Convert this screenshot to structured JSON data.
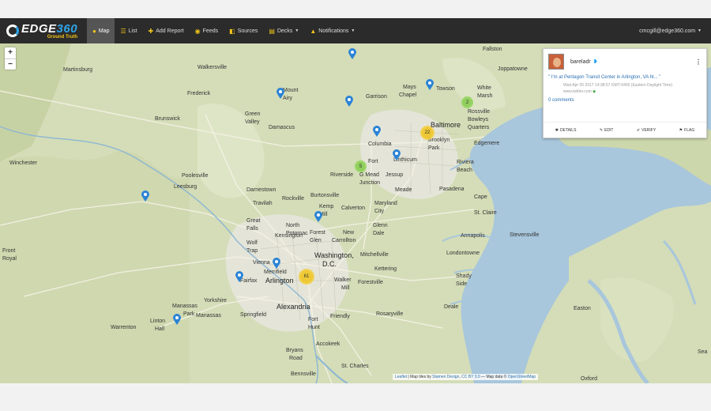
{
  "navbar": {
    "brand_name": "EDGE",
    "brand_number": "360",
    "brand_sub": "Ground Truth",
    "items": [
      {
        "label": "Map",
        "icon": "map-marker-icon",
        "glyph": "●"
      },
      {
        "label": "List",
        "icon": "list-icon",
        "glyph": "☰"
      },
      {
        "label": "Add Report",
        "icon": "plus-icon",
        "glyph": "✚"
      },
      {
        "label": "Feeds",
        "icon": "feed-icon",
        "glyph": "◉"
      },
      {
        "label": "Sources",
        "icon": "sources-icon",
        "glyph": "◧"
      },
      {
        "label": "Decks",
        "icon": "decks-icon",
        "glyph": "▤"
      },
      {
        "label": "Notifications",
        "icon": "bell-icon",
        "glyph": "▲"
      }
    ],
    "user_email": "cmcgill@edge360.com"
  },
  "map": {
    "zoom_in": "+",
    "zoom_out": "−",
    "places": [
      {
        "name": "Fallston"
      },
      {
        "name": "Martinsburg"
      },
      {
        "name": "Walkersville"
      },
      {
        "name": "Joppatowne"
      },
      {
        "name": "Mays"
      },
      {
        "name": "Chapel"
      },
      {
        "name": "Towson"
      },
      {
        "name": "White"
      },
      {
        "name": "Marsh"
      },
      {
        "name": "Frederick"
      },
      {
        "name": "Mount"
      },
      {
        "name": "Airy"
      },
      {
        "name": "Garrison"
      },
      {
        "name": "Green"
      },
      {
        "name": "Valley"
      },
      {
        "name": "Rossville"
      },
      {
        "name": "Bowleys"
      },
      {
        "name": "Quarters"
      },
      {
        "name": "Brunswick"
      },
      {
        "name": "Damascus"
      },
      {
        "name": "Baltimore"
      },
      {
        "name": "Brooklyn"
      },
      {
        "name": "Park"
      },
      {
        "name": "Columbia"
      },
      {
        "name": "Edgemere"
      },
      {
        "name": "Winchester"
      },
      {
        "name": "Fort"
      },
      {
        "name": "Linthicum"
      },
      {
        "name": "Meade"
      },
      {
        "name": "Riviera"
      },
      {
        "name": "Beach"
      },
      {
        "name": "Poolesville"
      },
      {
        "name": "Riverside"
      },
      {
        "name": "G Mead"
      },
      {
        "name": "Junction"
      },
      {
        "name": "Jessup"
      },
      {
        "name": "Pasadena"
      },
      {
        "name": "Leesburg"
      },
      {
        "name": "Darnestown"
      },
      {
        "name": "Burtonsville"
      },
      {
        "name": "Maryland"
      },
      {
        "name": "City"
      },
      {
        "name": "Cape"
      },
      {
        "name": "St. Claire"
      },
      {
        "name": "Travilah"
      },
      {
        "name": "Rockville"
      },
      {
        "name": "Calverton"
      },
      {
        "name": "Kemp"
      },
      {
        "name": "Mill"
      },
      {
        "name": "Great"
      },
      {
        "name": "Falls"
      },
      {
        "name": "North"
      },
      {
        "name": "Potomac"
      },
      {
        "name": "Glenn"
      },
      {
        "name": "Dale"
      },
      {
        "name": "Annapolis"
      },
      {
        "name": "Stevensville"
      },
      {
        "name": "Kensington"
      },
      {
        "name": "Forest"
      },
      {
        "name": "Glen"
      },
      {
        "name": "New"
      },
      {
        "name": "Carrollton"
      },
      {
        "name": "Wolf"
      },
      {
        "name": "Trap"
      },
      {
        "name": "Front"
      },
      {
        "name": "Royal"
      },
      {
        "name": "Londontowne"
      },
      {
        "name": "Washington,"
      },
      {
        "name": "D.C."
      },
      {
        "name": "Mitchellville"
      },
      {
        "name": "Vienna"
      },
      {
        "name": "Merrifield"
      },
      {
        "name": "Kettering"
      },
      {
        "name": "Arlington"
      },
      {
        "name": "Shady"
      },
      {
        "name": "Side"
      },
      {
        "name": "Fairfax"
      },
      {
        "name": "Walker"
      },
      {
        "name": "Forestville"
      },
      {
        "name": "Yorkshire"
      },
      {
        "name": "Mill"
      },
      {
        "name": "Manassas"
      },
      {
        "name": "Park"
      },
      {
        "name": "Alexandria"
      },
      {
        "name": "Springfield"
      },
      {
        "name": "Deale"
      },
      {
        "name": "Easton"
      },
      {
        "name": "Manassas"
      },
      {
        "name": "Linton"
      },
      {
        "name": "Hall"
      },
      {
        "name": "Fort"
      },
      {
        "name": "Hunt"
      },
      {
        "name": "Friendly"
      },
      {
        "name": "Rosaryville"
      },
      {
        "name": "Warrenton"
      },
      {
        "name": "Accokeek"
      },
      {
        "name": "Bryans"
      },
      {
        "name": "Road"
      },
      {
        "name": "St. Charles"
      },
      {
        "name": "Bennsville"
      },
      {
        "name": "Sea"
      },
      {
        "name": "Oxford"
      }
    ],
    "clusters": [
      {
        "label": "2",
        "color": "green"
      },
      {
        "label": "22",
        "color": "yellow"
      },
      {
        "label": "5",
        "color": "green"
      },
      {
        "label": "61",
        "color": "yellow"
      }
    ],
    "attribution": {
      "leaflet": "Leaflet",
      "text1": " | Map tiles by ",
      "stamen": "Stamen Design",
      "text2": ", ",
      "license": "CC BY 3.0",
      "text3": " — Map data © ",
      "osm": "OpenStreetMap"
    }
  },
  "card": {
    "username": "bareladr",
    "tweet_text": "\" I'm at Pentagon Transit Center in Arlington, VA ht... \"",
    "timestamp": "Wed Apr 05 2017 14:38:57 GMT-0400 (Eastern Daylight Time)",
    "source": "www.twitter.com",
    "comments": "0 comments",
    "actions": [
      {
        "label": "DETAILS",
        "icon": "gear-icon",
        "glyph": "✱"
      },
      {
        "label": "EDIT",
        "icon": "pencil-icon",
        "glyph": "✎"
      },
      {
        "label": "VERIFY",
        "icon": "check-icon",
        "glyph": "✔"
      },
      {
        "label": "FLAG",
        "icon": "flag-icon",
        "glyph": "⚑"
      }
    ]
  },
  "colors": {
    "navbar": "#2b2b2b",
    "accent": "#f0c419",
    "link": "#2a6fb0",
    "marker": "#2a83d6",
    "water": "#a8c6dc",
    "land": "#d4ddb8"
  }
}
